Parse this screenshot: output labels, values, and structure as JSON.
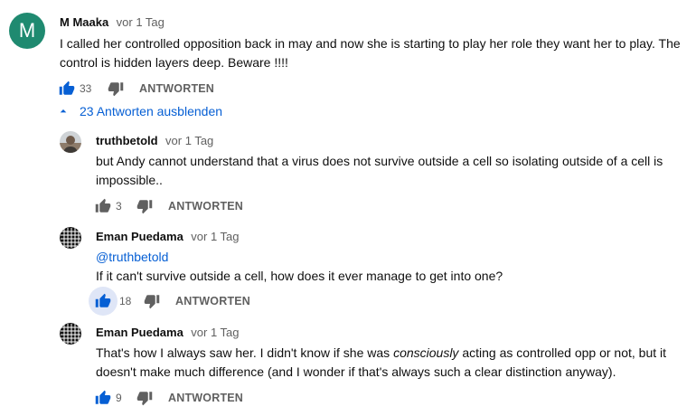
{
  "comment": {
    "avatar_letter": "M",
    "author": "M Maaka",
    "time": "vor 1 Tag",
    "text_line1": "I called her controlled opposition back in may and now she is starting to play her role they want her to play. The",
    "text_line2": "control is hidden layers deep. Beware  !!!!",
    "likes": "33",
    "reply_label": "ANTWORTEN"
  },
  "replies_toggle": {
    "label": "23 Antworten ausblenden",
    "icon": "chevron-up-icon"
  },
  "replies": [
    {
      "author": "truthbetold",
      "time": "vor 1 Tag",
      "text_line1": "but Andy cannot understand that a virus does not survive outside a cell so isolating outside of a cell is",
      "text_line2": "impossible..",
      "likes": "3",
      "reply_label": "ANTWORTEN"
    },
    {
      "author": "Eman Puedama",
      "time": "vor 1 Tag",
      "mention": "@truthbetold",
      "text_line2": "If it can't survive outside a cell, how does it ever manage to get into one?",
      "likes": "18",
      "liked": true,
      "reply_label": "ANTWORTEN"
    },
    {
      "author": "Eman Puedama",
      "time": "vor 1 Tag",
      "text_pre": "That's how I always saw her. I didn't know if she was ",
      "text_em": "consciously",
      "text_post": " acting as controlled opp or not, but it",
      "text_line2": "doesn't make much difference (and I wonder if that's always such a clear distinction anyway).",
      "likes": "9",
      "reply_label": "ANTWORTEN"
    }
  ],
  "colors": {
    "accent": "#065fd4",
    "secondary_text": "#606060",
    "avatar_m": "#1f8a70"
  }
}
